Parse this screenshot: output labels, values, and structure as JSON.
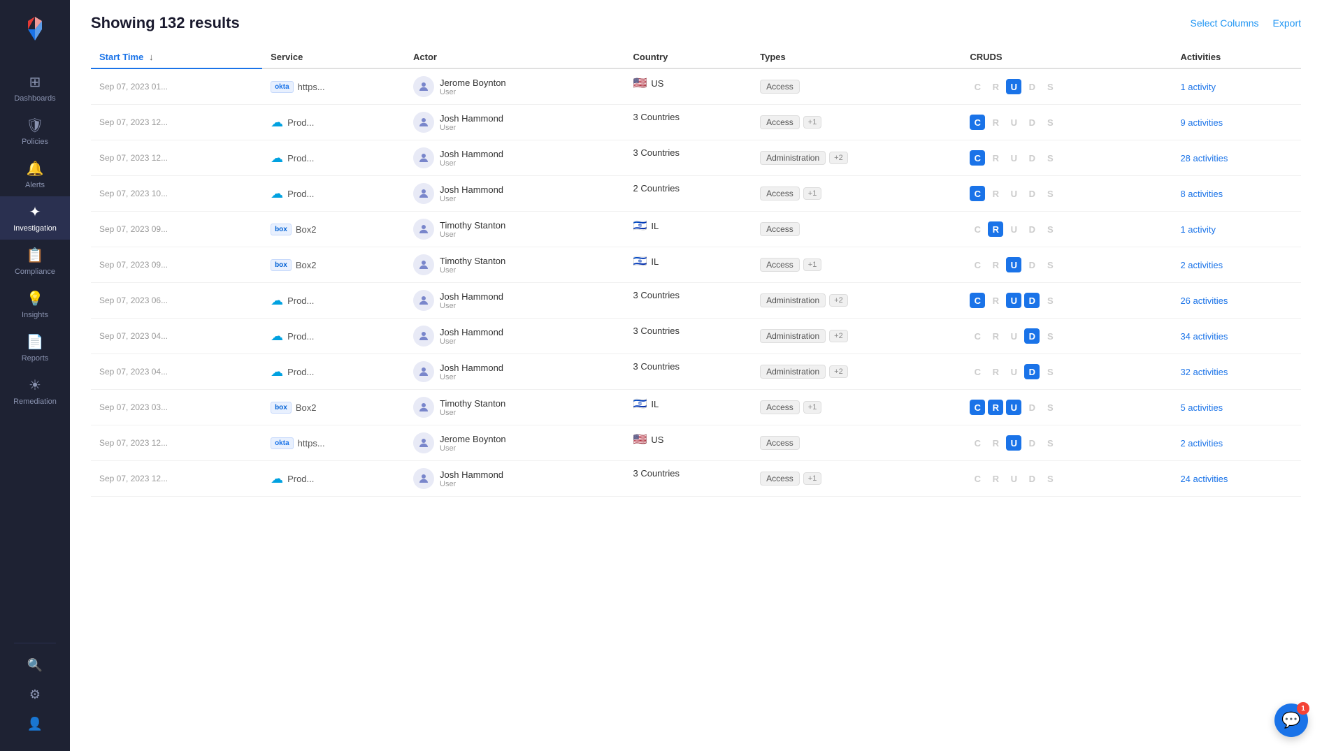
{
  "sidebar": {
    "logo_color": "#e53935",
    "items": [
      {
        "id": "dashboards",
        "label": "Dashboards",
        "icon": "⊞",
        "active": false
      },
      {
        "id": "policies",
        "label": "Policies",
        "icon": "🛡",
        "active": false
      },
      {
        "id": "alerts",
        "label": "Alerts",
        "icon": "🔔",
        "active": false
      },
      {
        "id": "investigation",
        "label": "Investigation",
        "icon": "✦",
        "active": true
      },
      {
        "id": "compliance",
        "label": "Compliance",
        "icon": "📋",
        "active": false
      },
      {
        "id": "insights",
        "label": "Insights",
        "icon": "💡",
        "active": false
      },
      {
        "id": "reports",
        "label": "Reports",
        "icon": "📄",
        "active": false
      },
      {
        "id": "remediation",
        "label": "Remediation",
        "icon": "☀",
        "active": false
      }
    ],
    "bottom_items": [
      {
        "id": "search",
        "icon": "🔍"
      },
      {
        "id": "settings",
        "icon": "⚙"
      },
      {
        "id": "profile",
        "icon": "👤"
      }
    ]
  },
  "header": {
    "result_count": "Showing 132 results",
    "select_columns_label": "Select Columns",
    "export_label": "Export"
  },
  "table": {
    "columns": [
      "Start Time",
      "Service",
      "Actor",
      "Country",
      "Types",
      "CRUDS",
      "Activities"
    ],
    "rows": [
      {
        "start_time": "Sep 07, 2023 01...",
        "service_badge": "okta",
        "service_name": "https...",
        "actor_name": "Jerome Boynton",
        "actor_role": "User",
        "country_flag": "🇺🇸",
        "country_name": "US",
        "type_label": "Access",
        "type_extra": null,
        "cruds": {
          "C": false,
          "R": false,
          "U": true,
          "D": false,
          "S": false
        },
        "activities": "1 activity"
      },
      {
        "start_time": "Sep 07, 2023 12...",
        "service_badge": "sfdc",
        "service_name": "Prod...",
        "actor_name": "Josh Hammond",
        "actor_role": "User",
        "country_flag": null,
        "country_name": "3 Countries",
        "type_label": "Access",
        "type_extra": "+1",
        "cruds": {
          "C": true,
          "R": false,
          "U": false,
          "D": false,
          "S": false
        },
        "activities": "9 activities"
      },
      {
        "start_time": "Sep 07, 2023 12...",
        "service_badge": "sfdc",
        "service_name": "Prod...",
        "actor_name": "Josh Hammond",
        "actor_role": "User",
        "country_flag": null,
        "country_name": "3 Countries",
        "type_label": "Administration",
        "type_extra": "+2",
        "cruds": {
          "C": true,
          "R": false,
          "U": false,
          "D": false,
          "S": false
        },
        "activities": "28 activities"
      },
      {
        "start_time": "Sep 07, 2023 10...",
        "service_badge": "sfdc",
        "service_name": "Prod...",
        "actor_name": "Josh Hammond",
        "actor_role": "User",
        "country_flag": null,
        "country_name": "2 Countries",
        "type_label": "Access",
        "type_extra": "+1",
        "cruds": {
          "C": true,
          "R": false,
          "U": false,
          "D": false,
          "S": false
        },
        "activities": "8 activities"
      },
      {
        "start_time": "Sep 07, 2023 09...",
        "service_badge": "box",
        "service_name": "Box2",
        "actor_name": "Timothy Stanton",
        "actor_role": "User",
        "country_flag": "🇮🇱",
        "country_name": "IL",
        "type_label": "Access",
        "type_extra": null,
        "cruds": {
          "C": false,
          "R": true,
          "U": false,
          "D": false,
          "S": false
        },
        "activities": "1 activity"
      },
      {
        "start_time": "Sep 07, 2023 09...",
        "service_badge": "box",
        "service_name": "Box2",
        "actor_name": "Timothy Stanton",
        "actor_role": "User",
        "country_flag": "🇮🇱",
        "country_name": "IL",
        "type_label": "Access",
        "type_extra": "+1",
        "cruds": {
          "C": false,
          "R": false,
          "U": true,
          "D": false,
          "S": false
        },
        "activities": "2 activities"
      },
      {
        "start_time": "Sep 07, 2023 06...",
        "service_badge": "sfdc",
        "service_name": "Prod...",
        "actor_name": "Josh Hammond",
        "actor_role": "User",
        "country_flag": null,
        "country_name": "3 Countries",
        "type_label": "Administration",
        "type_extra": "+2",
        "cruds": {
          "C": true,
          "R": false,
          "U": true,
          "D": true,
          "S": false
        },
        "activities": "26 activities"
      },
      {
        "start_time": "Sep 07, 2023 04...",
        "service_badge": "sfdc",
        "service_name": "Prod...",
        "actor_name": "Josh Hammond",
        "actor_role": "User",
        "country_flag": null,
        "country_name": "3 Countries",
        "type_label": "Administration",
        "type_extra": "+2",
        "cruds": {
          "C": false,
          "R": false,
          "U": false,
          "D": true,
          "S": false
        },
        "activities": "34 activities"
      },
      {
        "start_time": "Sep 07, 2023 04...",
        "service_badge": "sfdc",
        "service_name": "Prod...",
        "actor_name": "Josh Hammond",
        "actor_role": "User",
        "country_flag": null,
        "country_name": "3 Countries",
        "type_label": "Administration",
        "type_extra": "+2",
        "cruds": {
          "C": false,
          "R": false,
          "U": false,
          "D": true,
          "S": false
        },
        "activities": "32 activities"
      },
      {
        "start_time": "Sep 07, 2023 03...",
        "service_badge": "box",
        "service_name": "Box2",
        "actor_name": "Timothy Stanton",
        "actor_role": "User",
        "country_flag": "🇮🇱",
        "country_name": "IL",
        "type_label": "Access",
        "type_extra": "+1",
        "cruds": {
          "C": true,
          "R": true,
          "U": true,
          "D": false,
          "S": false
        },
        "activities": "5 activities"
      },
      {
        "start_time": "Sep 07, 2023 12...",
        "service_badge": "okta",
        "service_name": "https...",
        "actor_name": "Jerome Boynton",
        "actor_role": "User",
        "country_flag": "🇺🇸",
        "country_name": "US",
        "type_label": "Access",
        "type_extra": null,
        "cruds": {
          "C": false,
          "R": false,
          "U": true,
          "D": false,
          "S": false
        },
        "activities": "2 activities"
      },
      {
        "start_time": "Sep 07, 2023 12...",
        "service_badge": "sfdc",
        "service_name": "Prod...",
        "actor_name": "Josh Hammond",
        "actor_role": "User",
        "country_flag": null,
        "country_name": "3 Countries",
        "type_label": "Access",
        "type_extra": "+1",
        "cruds": {
          "C": false,
          "R": false,
          "U": false,
          "D": false,
          "S": false
        },
        "activities": "24 activities"
      }
    ]
  },
  "chat": {
    "badge_count": "1"
  }
}
